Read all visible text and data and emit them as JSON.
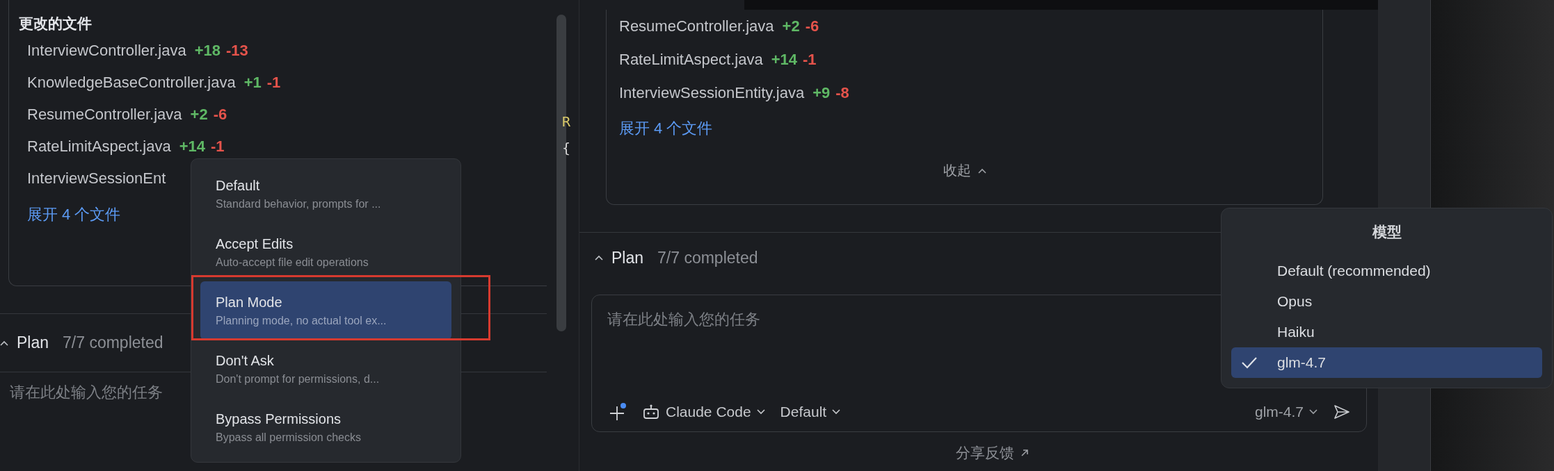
{
  "left_panel": {
    "title": "更改的文件",
    "files": [
      {
        "name": "InterviewController.java",
        "added": "+18",
        "removed": "-13"
      },
      {
        "name": "KnowledgeBaseController.java",
        "added": "+1",
        "removed": "-1"
      },
      {
        "name": "ResumeController.java",
        "added": "+2",
        "removed": "-6"
      },
      {
        "name": "RateLimitAspect.java",
        "added": "+14",
        "removed": "-1"
      },
      {
        "name": "InterviewSessionEnt"
      }
    ],
    "expand_link": "展开 4 个文件",
    "plan": {
      "label": "Plan",
      "status": "7/7 completed"
    },
    "input": {
      "placeholder": "请在此处输入您的任务"
    },
    "code_fragment": [
      "R",
      "{"
    ]
  },
  "mode_menu": {
    "items": [
      {
        "title": "Default",
        "description": "Standard behavior, prompts for ...",
        "selected": false
      },
      {
        "title": "Accept Edits",
        "description": "Auto-accept file edit operations",
        "selected": false
      },
      {
        "title": "Plan Mode",
        "description": "Planning mode, no actual tool ex...",
        "selected": true
      },
      {
        "title": "Don't Ask",
        "description": "Don't prompt for permissions, d...",
        "selected": false
      },
      {
        "title": "Bypass Permissions",
        "description": "Bypass all permission checks",
        "selected": false
      }
    ]
  },
  "right_panel": {
    "files": [
      {
        "name": "ResumeController.java",
        "added": "+2",
        "removed": "-6"
      },
      {
        "name": "RateLimitAspect.java",
        "added": "+14",
        "removed": "-1"
      },
      {
        "name": "InterviewSessionEntity.java",
        "added": "+9",
        "removed": "-8"
      }
    ],
    "expand_link": "展开 4 个文件",
    "collapse": "收起",
    "plan": {
      "label": "Plan",
      "status": "7/7 completed"
    },
    "input": {
      "placeholder": "请在此处输入您的任务"
    },
    "toolbar": {
      "agent": "Claude Code",
      "mode": "Default",
      "model": "glm-4.7"
    },
    "feedback": "分享反馈"
  },
  "model_menu": {
    "title": "模型",
    "items": [
      {
        "label": "Default (recommended)",
        "selected": false
      },
      {
        "label": "Opus",
        "selected": false
      },
      {
        "label": "Haiku",
        "selected": false
      },
      {
        "label": "glm-4.7",
        "selected": true
      }
    ]
  }
}
